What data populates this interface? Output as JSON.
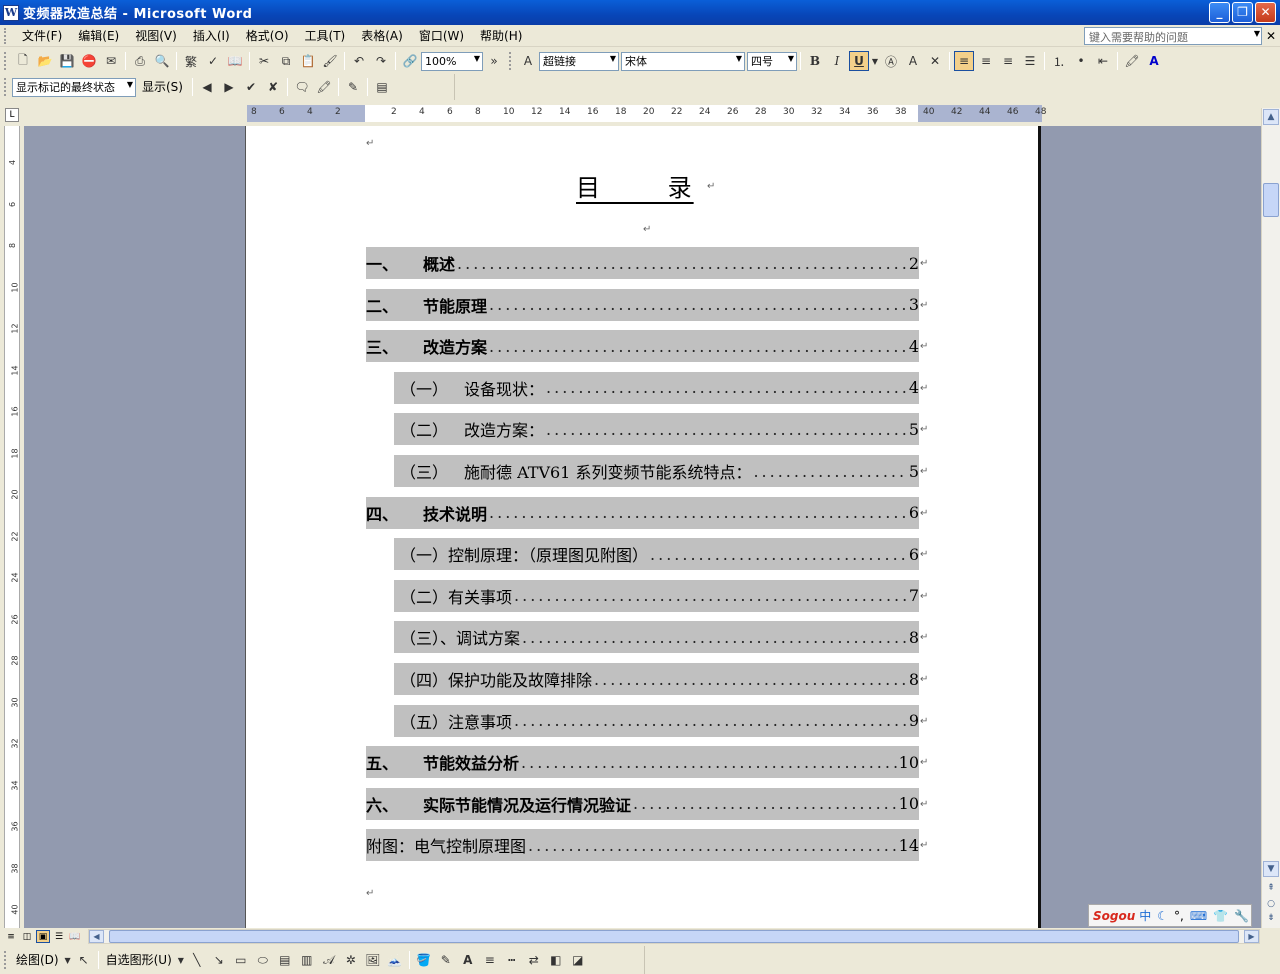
{
  "window": {
    "title": "变频器改造总结 - Microsoft Word",
    "min": "_",
    "max": "❐",
    "close": "✕"
  },
  "menubar": {
    "items": [
      "文件(F)",
      "编辑(E)",
      "视图(V)",
      "插入(I)",
      "格式(O)",
      "工具(T)",
      "表格(A)",
      "窗口(W)",
      "帮助(H)"
    ],
    "help_placeholder": "键入需要帮助的问题"
  },
  "toolbar": {
    "zoom": "100%",
    "style": "超链接",
    "font": "宋体",
    "size": "四号",
    "bold": "B",
    "italic": "I",
    "underline": "U"
  },
  "reviewbar": {
    "markup_state": "显示标记的最终状态",
    "show": "显示(S)"
  },
  "document": {
    "toc_title": "目 录",
    "entries": [
      {
        "num": "一、",
        "text": "概述",
        "page": "2",
        "level": 1
      },
      {
        "num": "二、",
        "text": "节能原理",
        "page": "3",
        "level": 1
      },
      {
        "num": "三、",
        "text": "改造方案",
        "page": "4",
        "level": 1
      },
      {
        "num": "（一）",
        "text": "设备现状：",
        "page": "4",
        "level": 2
      },
      {
        "num": "（二）",
        "text": "改造方案：",
        "page": "5",
        "level": 2
      },
      {
        "num": "（三）",
        "text": "施耐德 ATV61 系列变频节能系统特点：",
        "page": "5",
        "level": 2
      },
      {
        "num": "四、",
        "text": "技术说明",
        "page": "6",
        "level": 1
      },
      {
        "num": "",
        "text": "（一）控制原理：（原理图见附图）",
        "page": "6",
        "level": 3
      },
      {
        "num": "",
        "text": "（二）有关事项",
        "page": "7",
        "level": 3
      },
      {
        "num": "",
        "text": "（三）、调试方案",
        "page": "8",
        "level": 3
      },
      {
        "num": "",
        "text": "（四）保护功能及故障排除",
        "page": "8",
        "level": 3
      },
      {
        "num": "",
        "text": "（五）注意事项",
        "page": "9",
        "level": 3
      },
      {
        "num": "五、",
        "text": "节能效益分析",
        "page": "10",
        "level": 1
      },
      {
        "num": "六、",
        "text": "实际节能情况及运行情况验证",
        "page": "10",
        "level": 1
      },
      {
        "num": "",
        "text": "附图：电气控制原理图",
        "page": "14",
        "level": 0
      }
    ]
  },
  "drawbar": {
    "draw": "绘图(D)",
    "autoshapes": "自选图形(U)"
  },
  "ime": {
    "brand": "Sogou",
    "mode": "中"
  },
  "ruler_h": [
    "8",
    "6",
    "4",
    "2",
    "",
    "2",
    "4",
    "6",
    "8",
    "10",
    "12",
    "14",
    "16",
    "18",
    "20",
    "22",
    "24",
    "26",
    "28",
    "30",
    "32",
    "34",
    "36",
    "38",
    "40",
    "42",
    "44",
    "46",
    "48"
  ],
  "ruler_v": [
    "4",
    "6",
    "8",
    "10",
    "12",
    "14",
    "16",
    "18",
    "20",
    "22",
    "24",
    "26",
    "28",
    "30",
    "32",
    "34",
    "36",
    "38",
    "40"
  ]
}
